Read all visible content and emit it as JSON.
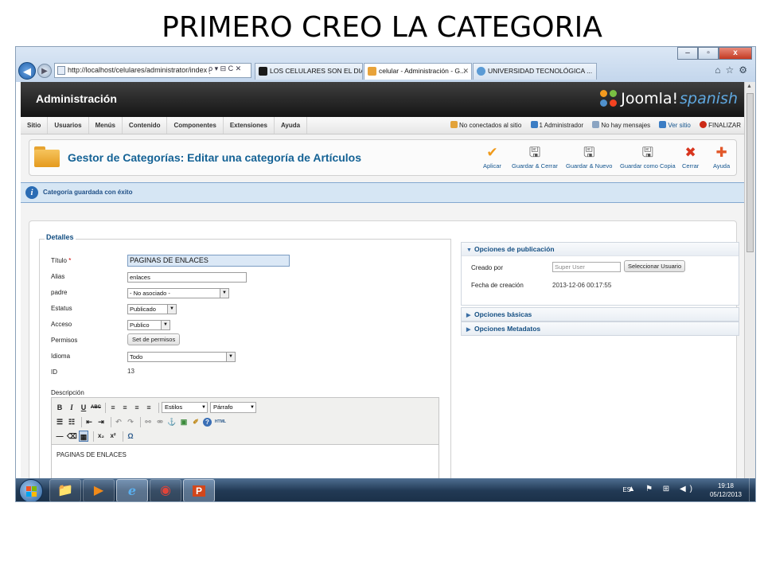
{
  "slide_title": "PRIMERO CREO LA CATEGORIA",
  "browser": {
    "window_controls": [
      "‒",
      "▫",
      "x"
    ],
    "address": "http://localhost/celulares/administrator/index.p",
    "address_tools": "ρ ▾ ⊟ C ✕",
    "tabs": [
      {
        "label": "LOS CELULARES SON EL DIABLO",
        "fav_color": "#1a1a1a"
      },
      {
        "label": "celular - Administración - G...",
        "fav_color": "#e8a33a"
      },
      {
        "label": "UNIVERSIDAD TECNOLÓGICA ...",
        "fav_color": "#5b9bd5"
      }
    ],
    "close_glyph": "✕",
    "right_tools": "⌂☆⚙"
  },
  "joomla": {
    "header_title": "Administración",
    "logo_word": "Joomla!",
    "logo_suffix": "spanish",
    "menu": [
      "Sitio",
      "Usuarios",
      "Menús",
      "Contenido",
      "Componentes",
      "Extensiones",
      "Ayuda"
    ],
    "status": [
      {
        "text": "No conectados al sitio",
        "color": "#e3a33a"
      },
      {
        "text": "1 Administrador",
        "color": "#3b7dc4"
      },
      {
        "text": "No hay mensajes",
        "color": "#8aa4c2"
      },
      {
        "text": "Ver sitio",
        "color": "#3b7dc4"
      },
      {
        "text": "FINALIZAR",
        "color": "#cc2a16"
      }
    ],
    "page_title": "Gestor de Categorías: Editar una categoría de Artículos",
    "toolbar": [
      {
        "label": "Aplicar",
        "icon": "check-icon",
        "glyph": "✔",
        "color": "#f09a1a"
      },
      {
        "label": "Guardar & Cerrar",
        "icon": "save-close-icon",
        "glyph": "🖫",
        "color": "#555555"
      },
      {
        "label": "Guardar & Nuevo",
        "icon": "save-new-icon",
        "glyph": "🖫",
        "color": "#555555"
      },
      {
        "label": "Guardar como Copia",
        "icon": "save-copy-icon",
        "glyph": "🖫",
        "color": "#555555"
      },
      {
        "label": "Cerrar",
        "icon": "close-icon",
        "glyph": "✖",
        "color": "#d8351e"
      },
      {
        "label": "Ayuda",
        "icon": "help-icon",
        "glyph": "✚",
        "color": "#e2582a"
      }
    ],
    "message": "Categoría guardada con éxito",
    "message_icon": "i",
    "details": {
      "legend": "Detalles",
      "title_label": "Título",
      "title_required": "*",
      "title_value": "PAGINAS DE ENLACES",
      "alias_label": "Alias",
      "alias_value": "enlaces",
      "parent_label": "padre",
      "parent_value": "- No asociado -",
      "status_label": "Estatus",
      "status_value": "Publicado",
      "access_label": "Acceso",
      "access_value": "Publico",
      "perms_label": "Permisos",
      "perms_button": "Set de permisos",
      "lang_label": "Idioma",
      "lang_value": "Todo",
      "id_label": "ID",
      "id_value": "13",
      "desc_label": "Descripción",
      "dropdown_glyph": "▼"
    },
    "editor": {
      "row1_buttons": [
        "B",
        "I",
        "U",
        "ABC"
      ],
      "align_buttons": [
        "≡",
        "≡",
        "≡",
        "≡"
      ],
      "styles_select": "Estilos",
      "format_select": "Párrafo",
      "row2_buttons": [
        "☰",
        "☷",
        "⇤",
        "⇥",
        "↶",
        "↷",
        "⚯",
        "⚮",
        "⚓",
        "▣",
        "✐",
        "?",
        "HTML"
      ],
      "row3_buttons": [
        "—",
        "⌫",
        "▦",
        "x₂",
        "x²",
        "Ω"
      ],
      "content": "PAGINAS DE ENLACES"
    },
    "publishing": {
      "header": "Opciones de publicación",
      "created_by_label": "Creado por",
      "created_by_value": "Super User",
      "select_user_button": "Seleccionar Usuario",
      "created_date_label": "Fecha de creación",
      "created_date_value": "2013-12-06 00:17:55",
      "open_glyph": "▼",
      "closed_glyph": "▶"
    },
    "basic_options": "Opciones básicas",
    "metadata_options": "Opciones Metadatos"
  },
  "taskbar": {
    "apps": [
      {
        "name": "explorer",
        "glyph": "📁"
      },
      {
        "name": "media-player",
        "glyph": "▶"
      },
      {
        "name": "internet-explorer",
        "glyph": "e"
      },
      {
        "name": "chrome",
        "glyph": "◉"
      },
      {
        "name": "powerpoint",
        "glyph": "P"
      }
    ],
    "language": "ES",
    "tray_icons": "▲ ⚑ ⊞ ◀)",
    "time": "19:18",
    "date": "05/12/2013"
  }
}
